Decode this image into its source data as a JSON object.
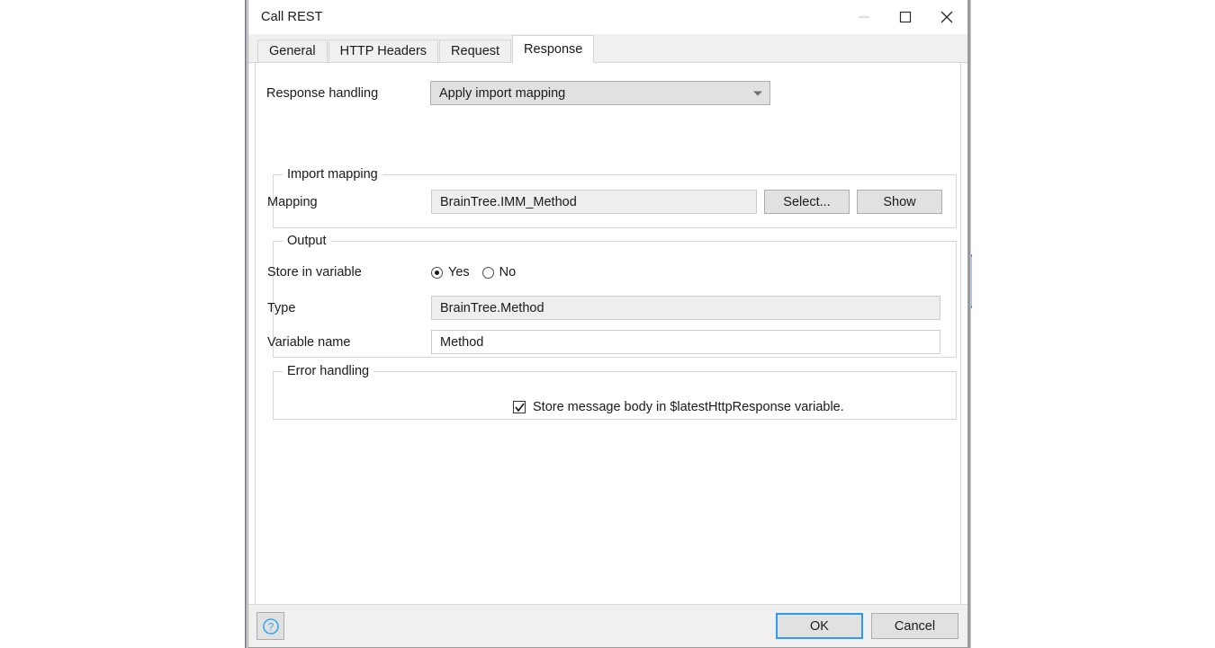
{
  "window": {
    "title": "Call REST",
    "controls": {
      "minimize": "minimize",
      "maximize": "maximize",
      "close": "close"
    }
  },
  "tabs": [
    {
      "label": "General",
      "active": false
    },
    {
      "label": "HTTP Headers",
      "active": false
    },
    {
      "label": "Request",
      "active": false
    },
    {
      "label": "Response",
      "active": true
    }
  ],
  "response_tab": {
    "response_handling": {
      "label": "Response handling",
      "value": "Apply import mapping"
    },
    "import_mapping": {
      "group_title": "Import mapping",
      "mapping_label": "Mapping",
      "mapping_value": "BrainTree.IMM_Method",
      "select_button": "Select...",
      "show_button": "Show"
    },
    "output": {
      "group_title": "Output",
      "store_in_variable_label": "Store in variable",
      "radio_yes": "Yes",
      "radio_no": "No",
      "store_in_variable_value": "Yes",
      "type_label": "Type",
      "type_value": "BrainTree.Method",
      "variable_name_label": "Variable name",
      "variable_name_value": "Method"
    },
    "error_handling": {
      "group_title": "Error handling",
      "checkbox_label": "Store message body in $latestHttpResponse variable.",
      "checkbox_checked": true
    }
  },
  "footer": {
    "help_button": "?",
    "ok_button": "OK",
    "cancel_button": "Cancel"
  },
  "colors": {
    "accent_focus": "#2c9bf0",
    "help_icon": "#37a8e8",
    "dialog_bg": "#ffffff",
    "chrome_bg": "#f0f0f0",
    "field_readonly_bg": "#eeeeee",
    "button_bg": "#e1e1e1"
  }
}
